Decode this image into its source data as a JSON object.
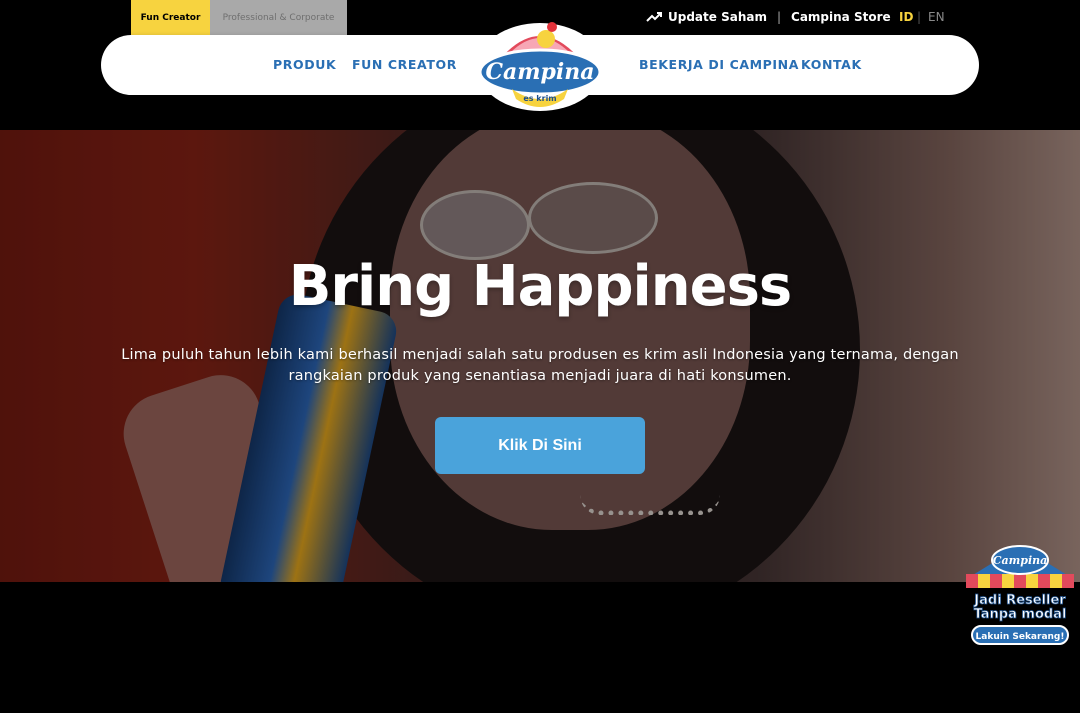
{
  "topbar": {
    "tab_fun": "Fun Creator",
    "tab_pro": "Professional & Corporate",
    "update_saham": "Update Saham",
    "separator": "|",
    "campina_store": "Campina Store",
    "lang_id": "ID",
    "lang_sep": "|",
    "lang_en": "EN"
  },
  "nav": {
    "items": [
      "PRODUK",
      "FUN CREATOR",
      "BEKERJA DI CAMPINA",
      "KONTAK"
    ]
  },
  "logo": {
    "brand": "Campina",
    "tagline": "es krim"
  },
  "hero": {
    "title": "Bring Happiness",
    "subtitle": "Lima puluh tahun lebih kami berhasil menjadi salah satu produsen es krim asli Indonesia yang ternama, dengan rangkaian produk yang senantiasa menjadi juara di hati konsumen.",
    "cta": "Klik Di Sini"
  },
  "badge": {
    "brand": "Campina",
    "line1": "Jadi Reseller",
    "line2": "Tanpa modal",
    "line3": "Lakuin Sekarang!"
  },
  "colors": {
    "accent_yellow": "#f7d33f",
    "nav_blue": "#2a6fb4",
    "cta_blue": "#4aa3db"
  }
}
